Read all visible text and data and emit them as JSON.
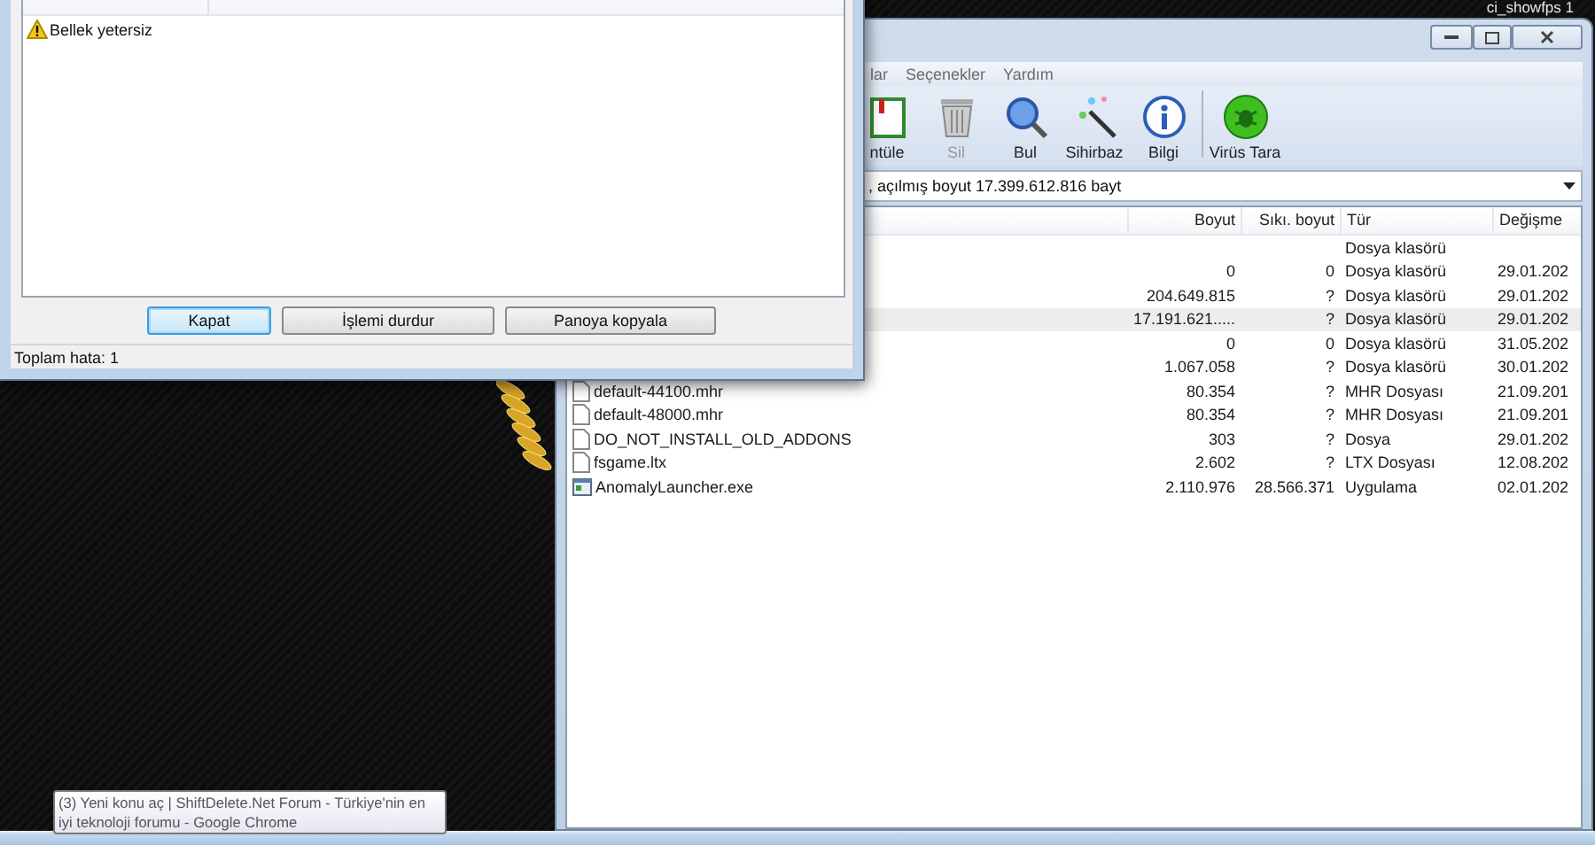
{
  "desktop": {
    "caption": "ci_showfps 1"
  },
  "main_window": {
    "menu": [
      "lar",
      "Seçenekler",
      "Yardım"
    ],
    "toolbar": [
      {
        "label": "ntüle",
        "kind": "view",
        "disabled": false,
        "separator_before": false
      },
      {
        "label": "Sil",
        "kind": "delete",
        "disabled": true,
        "separator_before": false
      },
      {
        "label": "Bul",
        "kind": "find",
        "disabled": false,
        "separator_before": false
      },
      {
        "label": "Sihirbaz",
        "kind": "wizard",
        "disabled": false,
        "separator_before": false
      },
      {
        "label": "Bilgi",
        "kind": "info",
        "disabled": false,
        "separator_before": false
      },
      {
        "label": "Virüs Tara",
        "kind": "virus",
        "disabled": false,
        "separator_before": true
      }
    ],
    "address": ", açılmış boyut 17.399.612.816 bayt",
    "columns": [
      "Boyut",
      "Sıkı. boyut",
      "Tür",
      "Değişme"
    ],
    "rows": [
      {
        "type": "Dosya klasörü",
        "selected": false
      },
      {
        "size": "0",
        "packed": "0",
        "type": "Dosya klasörü",
        "modified": "29.01.202",
        "selected": false
      },
      {
        "size": "204.649.815",
        "packed": "?",
        "type": "Dosya klasörü",
        "modified": "29.01.202",
        "selected": false
      },
      {
        "size": "17.191.621.....",
        "packed": "?",
        "type": "Dosya klasörü",
        "modified": "29.01.202",
        "selected": true
      },
      {
        "size": "0",
        "packed": "0",
        "type": "Dosya klasörü",
        "modified": "31.05.202",
        "selected": false
      },
      {
        "size": "1.067.058",
        "packed": "?",
        "type": "Dosya klasörü",
        "modified": "30.01.202",
        "selected": false
      },
      {
        "kind": "file",
        "name": "default-44100.mhr",
        "size": "80.354",
        "packed": "?",
        "type": "MHR Dosyası",
        "modified": "21.09.201",
        "selected": false
      },
      {
        "kind": "file",
        "name": "default-48000.mhr",
        "size": "80.354",
        "packed": "?",
        "type": "MHR Dosyası",
        "modified": "21.09.201",
        "selected": false
      },
      {
        "kind": "file",
        "name": "DO_NOT_INSTALL_OLD_ADDONS",
        "size": "303",
        "packed": "?",
        "type": "Dosya",
        "modified": "29.01.202",
        "selected": false
      },
      {
        "kind": "file",
        "name": "fsgame.ltx",
        "size": "2.602",
        "packed": "?",
        "type": "LTX Dosyası",
        "modified": "12.08.202",
        "selected": false
      },
      {
        "kind": "exe",
        "name": "AnomalyLauncher.exe",
        "size": "2.110.976",
        "packed": "28.566.371",
        "type": "Uygulama",
        "modified": "02.01.202",
        "selected": false
      }
    ]
  },
  "error_dialog": {
    "items": [
      {
        "kind": "warning",
        "text": "Bellek yetersiz"
      }
    ],
    "buttons": [
      {
        "label": "Kapat",
        "focused": true
      },
      {
        "label": "İşlemi durdur",
        "focused": false
      },
      {
        "label": "Panoya kopyala",
        "focused": false
      }
    ],
    "status": "Toplam hata: 1"
  },
  "tooltip": "(3) Yeni konu aç | ShiftDelete.Net Forum - Türkiye'nin en iyi teknoloji forumu - Google Chrome"
}
